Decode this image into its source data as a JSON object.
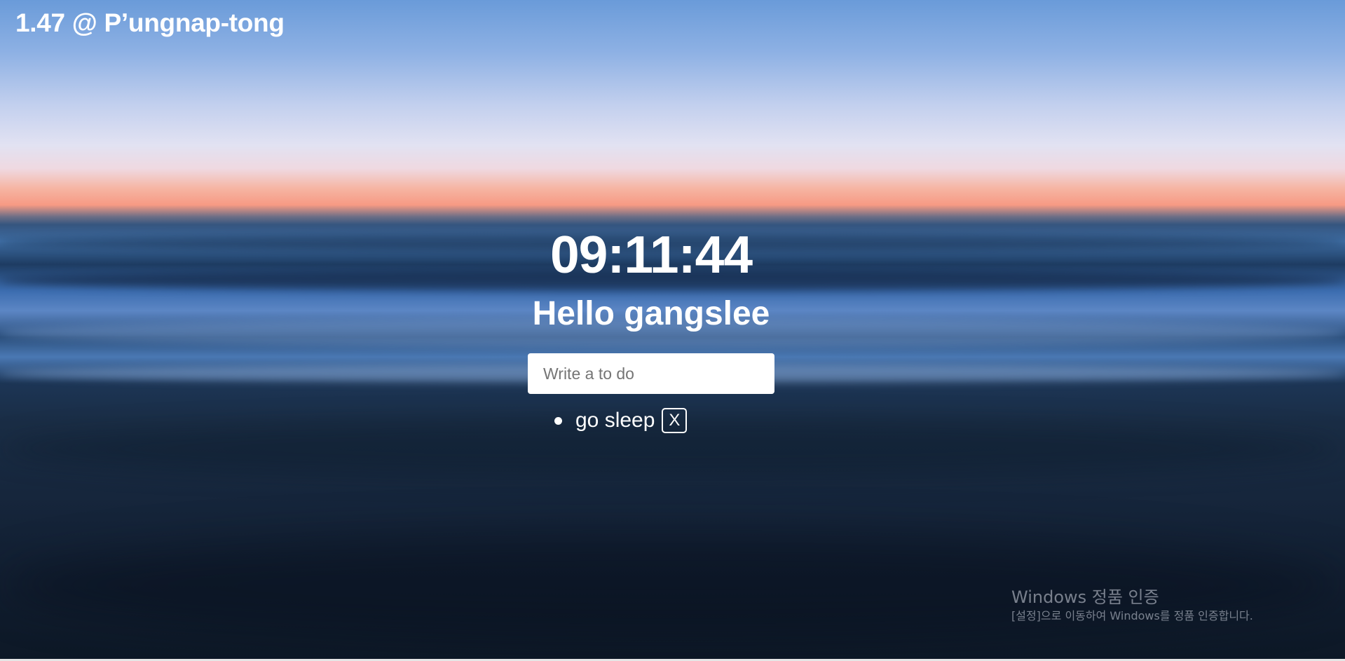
{
  "weather": {
    "text": "1.47 @ P’ungnap-tong"
  },
  "clock": {
    "time": "09:11:44"
  },
  "greeting": {
    "text": "Hello gangslee"
  },
  "todo": {
    "placeholder": "Write a to do",
    "value": "",
    "items": [
      {
        "text": "go sleep",
        "delete_label": "X"
      }
    ]
  },
  "watermark": {
    "title": "Windows 정품 인증",
    "subtitle": "[설정]으로 이동하여 Windows를 정품 인증합니다."
  },
  "colors": {
    "text": "#ffffff",
    "input_background": "#ffffff",
    "placeholder": "#757575"
  }
}
